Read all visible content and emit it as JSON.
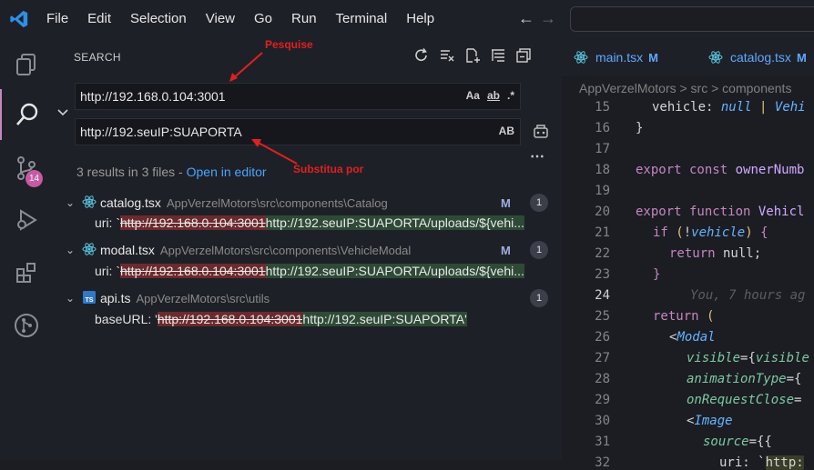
{
  "menu": [
    "File",
    "Edit",
    "Selection",
    "View",
    "Go",
    "Run",
    "Terminal",
    "Help"
  ],
  "activity": {
    "scm_badge": "14"
  },
  "sidebar": {
    "title": "SEARCH",
    "search_value": "http://192.168.0.104:3001",
    "search_opts": [
      "Aa",
      "ab",
      ".*"
    ],
    "replace_value": "http://192.seuIP:SUAPORTA",
    "replace_opts": [
      "AB"
    ],
    "annot_search": "Pesquise",
    "annot_replace": "Substitua por",
    "summary": "3 results in 3 files - ",
    "summary_link": "Open in editor",
    "more": "⋯",
    "files": [
      {
        "name": "catalog.tsx",
        "path": "AppVerzelMotors\\src\\components\\Catalog",
        "mod": "M",
        "count": "1",
        "prefix": "uri: `",
        "old": "http://192.168.0.104:3001",
        "new": "http://192.seuIP:SUAPORTA/uploads/${vehi..."
      },
      {
        "name": "modal.tsx",
        "path": "AppVerzelMotors\\src\\components\\VehicleModal",
        "mod": "M",
        "count": "1",
        "prefix": "uri: `",
        "old": "http://192.168.0.104:3001",
        "new": "http://192.seuIP:SUAPORTA/uploads/${vehi..."
      },
      {
        "name": "api.ts",
        "path": "AppVerzelMotors\\src\\utils",
        "mod": "",
        "count": "1",
        "prefix": "baseURL: '",
        "old": "http://192.168.0.104:3001",
        "new": "http://192.seuIP:SUAPORTA'"
      }
    ]
  },
  "editor": {
    "tabs": [
      {
        "name": "main.tsx",
        "mod": "M"
      },
      {
        "name": "catalog.tsx",
        "mod": "M"
      }
    ],
    "breadcrumb": "AppVerzelMotors > src > components",
    "line_numbers": [
      "15",
      "16",
      "17",
      "18",
      "19",
      "20",
      "21",
      "22",
      "23",
      "24",
      "25",
      "26",
      "27",
      "28",
      "29",
      "30",
      "31",
      "32"
    ],
    "blame": "You, 7 hours ag"
  }
}
